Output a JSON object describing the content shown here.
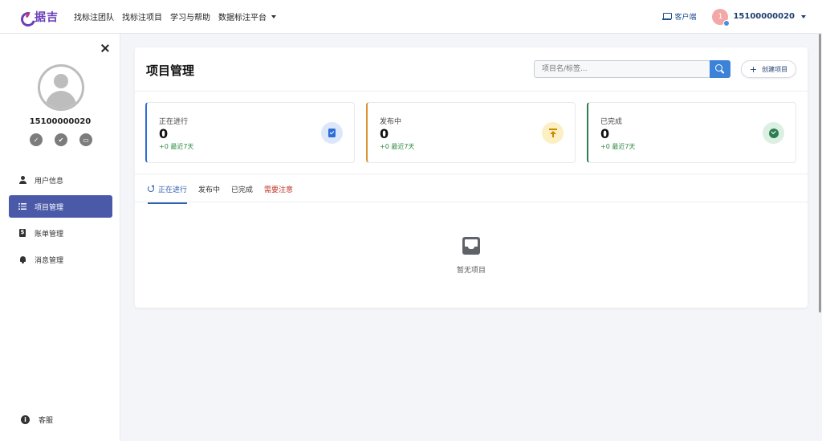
{
  "header": {
    "logo_text": "据吉",
    "nav": [
      "找标注团队",
      "找标注项目",
      "学习与帮助",
      "数据标注平台"
    ],
    "client_link": "客户端",
    "avatar_initial": "1",
    "username": "15100000020"
  },
  "sidebar": {
    "username": "15100000020",
    "menu": [
      {
        "label": "用户信息",
        "icon": "person-icon"
      },
      {
        "label": "项目管理",
        "icon": "list-icon",
        "active": true
      },
      {
        "label": "账单管理",
        "icon": "file-dollar-icon"
      },
      {
        "label": "消息管理",
        "icon": "bell-icon"
      }
    ],
    "service": "客服"
  },
  "main": {
    "title": "项目管理",
    "search_placeholder": "项目名/标签...",
    "create_label": "创建项目",
    "stats": [
      {
        "label": "正在进行",
        "value": "0",
        "delta": "+0 最近7天",
        "color": "#2f6ed8"
      },
      {
        "label": "发布中",
        "value": "0",
        "delta": "+0 最近7天",
        "color": "#e0912f"
      },
      {
        "label": "已完成",
        "value": "0",
        "delta": "+0 最近7天",
        "color": "#2e7d50"
      }
    ],
    "tabs": [
      "正在进行",
      "发布中",
      "已完成",
      "需要注意"
    ],
    "empty_text": "暂无项目"
  }
}
